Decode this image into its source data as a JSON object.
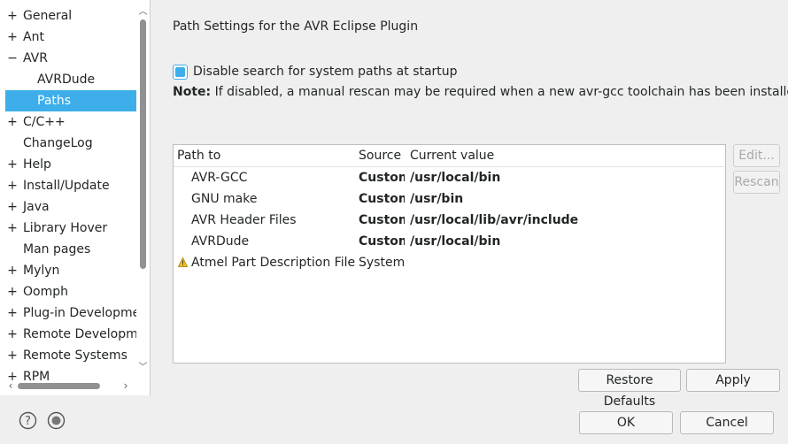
{
  "tree": {
    "items": [
      {
        "label": "General",
        "expander": "+"
      },
      {
        "label": "Ant",
        "expander": "+"
      },
      {
        "label": "AVR",
        "expander": "−"
      },
      {
        "label": "AVRDude",
        "expander": ""
      },
      {
        "label": "Paths",
        "expander": ""
      },
      {
        "label": "C/C++",
        "expander": "+"
      },
      {
        "label": "ChangeLog",
        "expander": ""
      },
      {
        "label": "Help",
        "expander": "+"
      },
      {
        "label": "Install/Update",
        "expander": "+"
      },
      {
        "label": "Java",
        "expander": "+"
      },
      {
        "label": "Library Hover",
        "expander": "+"
      },
      {
        "label": "Man pages",
        "expander": ""
      },
      {
        "label": "Mylyn",
        "expander": "+"
      },
      {
        "label": "Oomph",
        "expander": "+"
      },
      {
        "label": "Plug-in Development",
        "expander": "+"
      },
      {
        "label": "Remote Development",
        "expander": "+"
      },
      {
        "label": "Remote Systems",
        "expander": "+"
      },
      {
        "label": "RPM",
        "expander": "+"
      }
    ],
    "selected": "Paths"
  },
  "page": {
    "title": "Path Settings for the AVR Eclipse Plugin",
    "disable_search_label": "Disable search for system paths at startup",
    "disable_search_checked": true,
    "note_label": "Note:",
    "note_text": " If disabled, a manual rescan may be required when a new avr-gcc toolchain has been installed."
  },
  "table": {
    "headers": {
      "path": "Path to",
      "source": "Source",
      "value": "Current value"
    },
    "rows": [
      {
        "path": "AVR-GCC",
        "source": "Custom",
        "value": "/usr/local/bin",
        "warning": false
      },
      {
        "path": "GNU make",
        "source": "Custom",
        "value": "/usr/bin",
        "warning": false
      },
      {
        "path": "AVR Header Files",
        "source": "Custom",
        "value": "/usr/local/lib/avr/include",
        "warning": false
      },
      {
        "path": "AVRDude",
        "source": "Custom",
        "value": "/usr/local/bin",
        "warning": false
      },
      {
        "path": "Atmel Part Description Files",
        "source": "System",
        "value": "",
        "warning": true
      }
    ]
  },
  "buttons": {
    "edit": "Edit...",
    "rescan": "Rescan",
    "restore_defaults": "Restore Defaults",
    "apply": "Apply",
    "ok": "OK",
    "cancel": "Cancel"
  },
  "colors": {
    "accent": "#3daee9",
    "warning": "#f0c420"
  }
}
